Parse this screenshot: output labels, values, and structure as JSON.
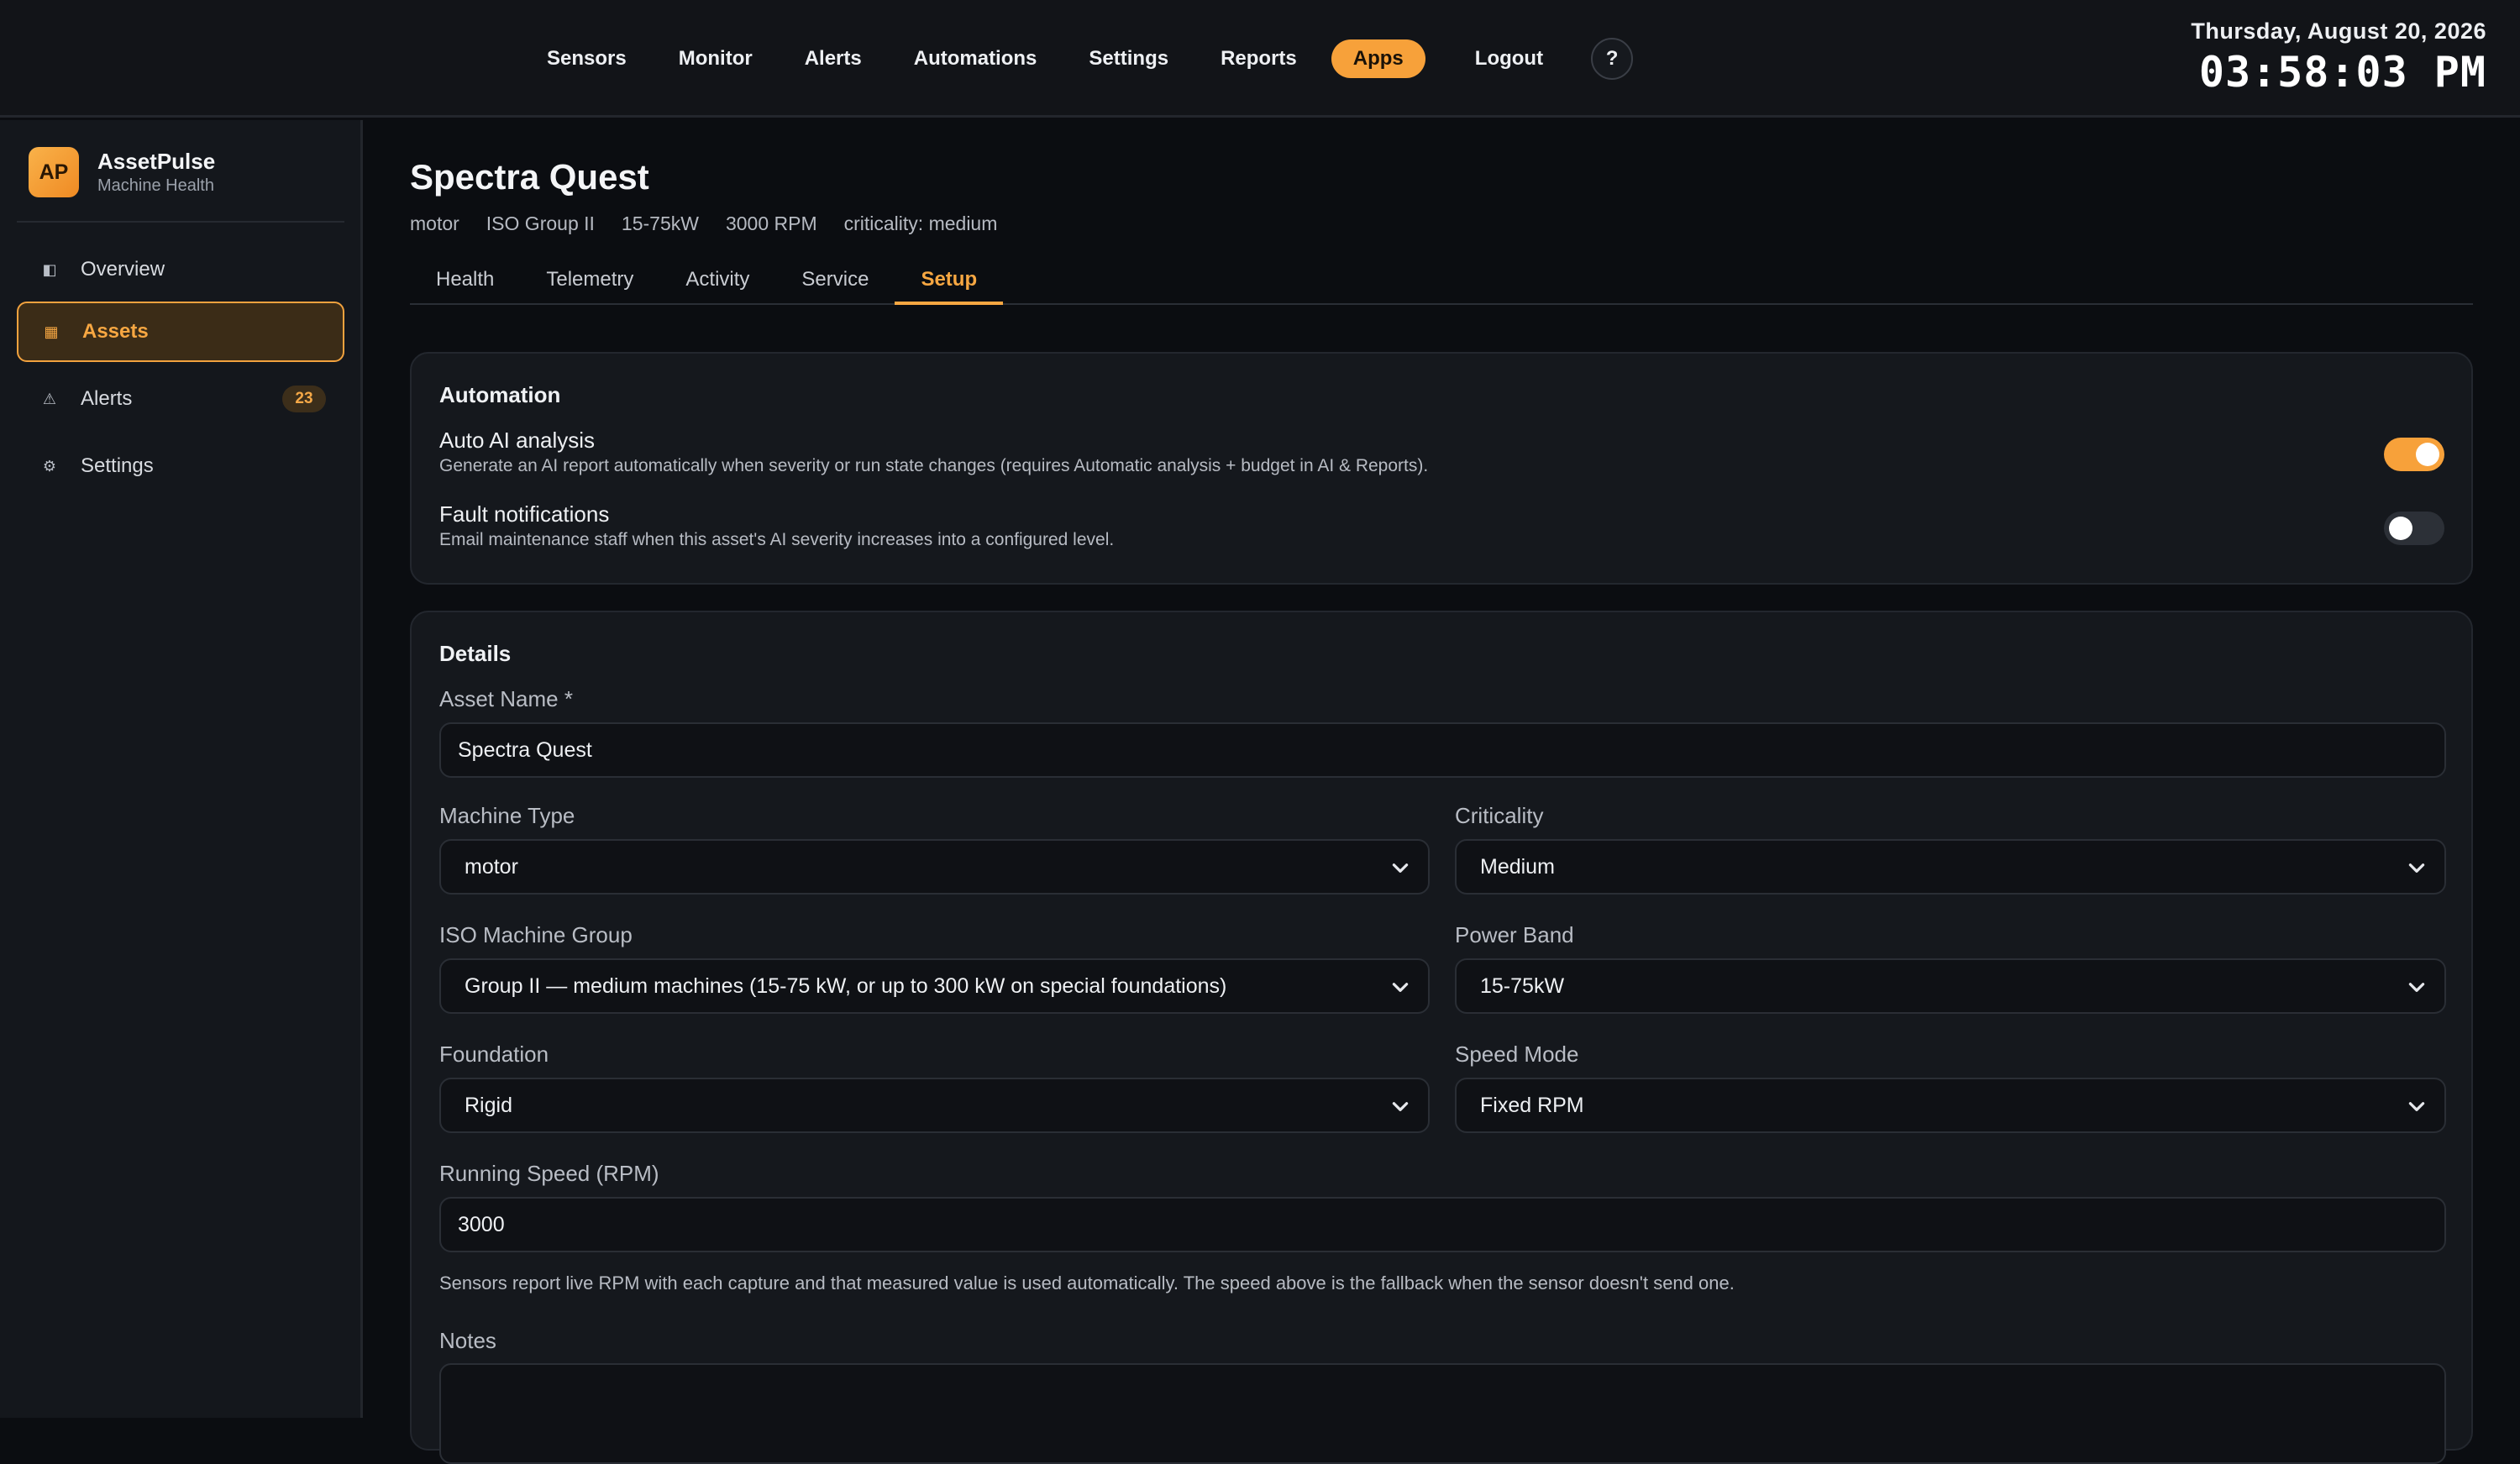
{
  "topnav": {
    "items": [
      "Sensors",
      "Monitor",
      "Alerts",
      "Automations",
      "Settings",
      "Reports"
    ],
    "active_item": "Apps",
    "logout": "Logout",
    "help": "?"
  },
  "clock": {
    "date": "Thursday, August 20, 2026",
    "time": "03:58:03 PM"
  },
  "brand": {
    "logo": "AP",
    "name": "AssetPulse",
    "subtitle": "Machine Health"
  },
  "sidebar": {
    "items": [
      {
        "label": "Overview",
        "icon": "overview-icon",
        "glyph": "◧"
      },
      {
        "label": "Assets",
        "icon": "assets-grid-icon",
        "glyph": "▦"
      },
      {
        "label": "Alerts",
        "icon": "warning-icon",
        "glyph": "⚠",
        "badge": "23"
      },
      {
        "label": "Settings",
        "icon": "gear-icon",
        "glyph": "⚙"
      }
    ],
    "active": "Assets"
  },
  "asset": {
    "title": "Spectra Quest",
    "meta": [
      "motor",
      "ISO Group II",
      "15-75kW",
      "3000 RPM",
      "criticality: medium"
    ]
  },
  "tabs": [
    "Health",
    "Telemetry",
    "Activity",
    "Service",
    "Setup"
  ],
  "active_tab": "Setup",
  "automation": {
    "title": "Automation",
    "auto_ai": {
      "title": "Auto AI analysis",
      "desc": "Generate an AI report automatically when severity or run state changes (requires Automatic analysis + budget in AI & Reports).",
      "enabled": true
    },
    "fault": {
      "title": "Fault notifications",
      "desc": "Email maintenance staff when this asset's AI severity increases into a configured level.",
      "enabled": false
    }
  },
  "details": {
    "title": "Details",
    "asset_name_label": "Asset Name *",
    "asset_name_value": "Spectra Quest",
    "machine_type_label": "Machine Type",
    "machine_type_value": "motor",
    "criticality_label": "Criticality",
    "criticality_value": "Medium",
    "iso_group_label": "ISO Machine Group",
    "iso_group_value": "Group II — medium machines (15-75 kW, or up to 300 kW on special foundations)",
    "power_band_label": "Power Band",
    "power_band_value": "15-75kW",
    "foundation_label": "Foundation",
    "foundation_value": "Rigid",
    "speed_mode_label": "Speed Mode",
    "speed_mode_value": "Fixed RPM",
    "running_speed_label": "Running Speed (RPM)",
    "running_speed_value": "3000",
    "speed_hint": "Sensors report live RPM with each capture and that measured value is used automatically. The speed above is the fallback when the sensor doesn't send one.",
    "notes_label": "Notes",
    "notes_value": ""
  },
  "colors": {
    "accent": "#f7a13a",
    "background": "#0b0d11",
    "panel": "#15181d"
  }
}
